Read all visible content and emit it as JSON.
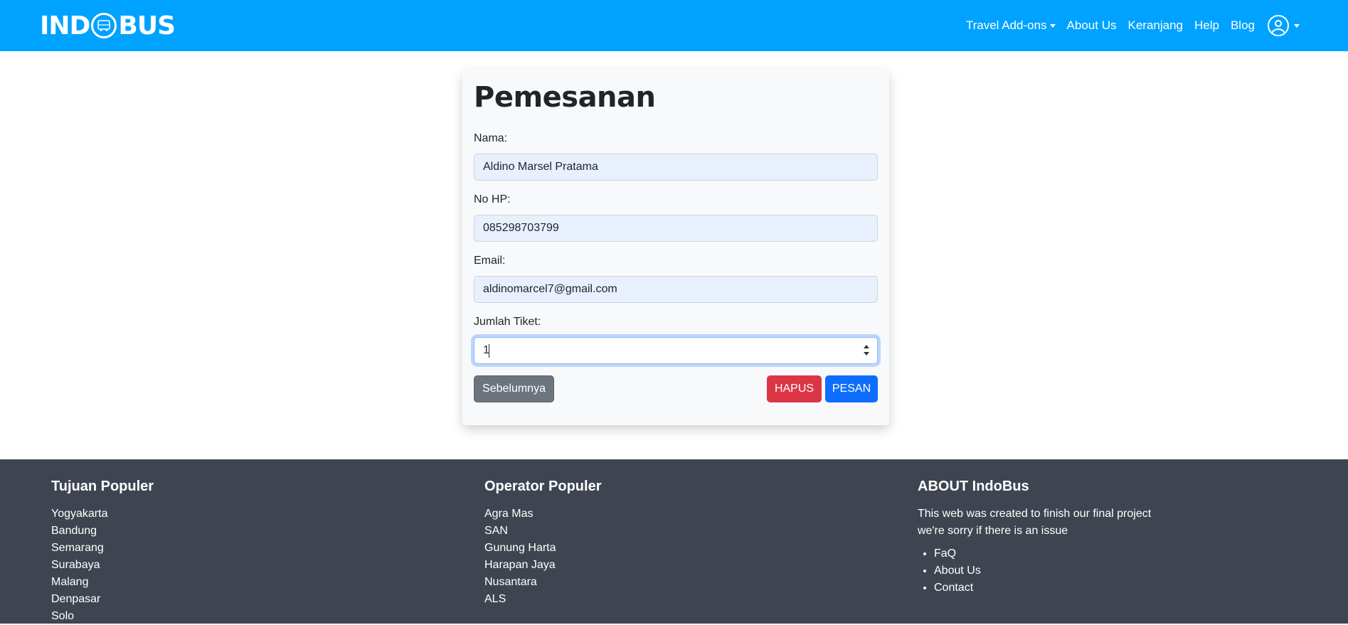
{
  "navbar": {
    "logo_left": "IND",
    "logo_right": "BUS",
    "links": [
      "Travel Add-ons",
      "About Us",
      "Keranjang",
      "Help",
      "Blog"
    ]
  },
  "form": {
    "title": "Pemesanan",
    "nama_label": "Nama:",
    "nama_value": "Aldino Marsel Pratama",
    "hp_label": "No HP:",
    "hp_value": "085298703799",
    "email_label": "Email:",
    "email_value": "aldinomarcel7@gmail.com",
    "tiket_label": "Jumlah Tiket:",
    "tiket_value": "1",
    "btn_prev": "Sebelumnya",
    "btn_delete": "HAPUS",
    "btn_order": "PESAN"
  },
  "footer": {
    "col1_title": "Tujuan Populer",
    "col1_items": [
      "Yogyakarta",
      "Bandung",
      "Semarang",
      "Surabaya",
      "Malang",
      "Denpasar",
      "Solo"
    ],
    "col2_title": "Operator Populer",
    "col2_items": [
      "Agra Mas",
      "SAN",
      "Gunung Harta",
      "Harapan Jaya",
      "Nusantara",
      "ALS"
    ],
    "col3_title": "ABOUT IndoBus",
    "col3_text1": "This web was created to finish our final project",
    "col3_text2": "we're sorry if there is an issue",
    "col3_links": [
      "FaQ",
      "About Us",
      "Contact"
    ]
  },
  "colors": {
    "navbar": "#00a2ff",
    "footer": "#3f4550",
    "btn_secondary": "#6c757d",
    "btn_danger": "#dc3545",
    "btn_primary": "#0d6efd"
  }
}
